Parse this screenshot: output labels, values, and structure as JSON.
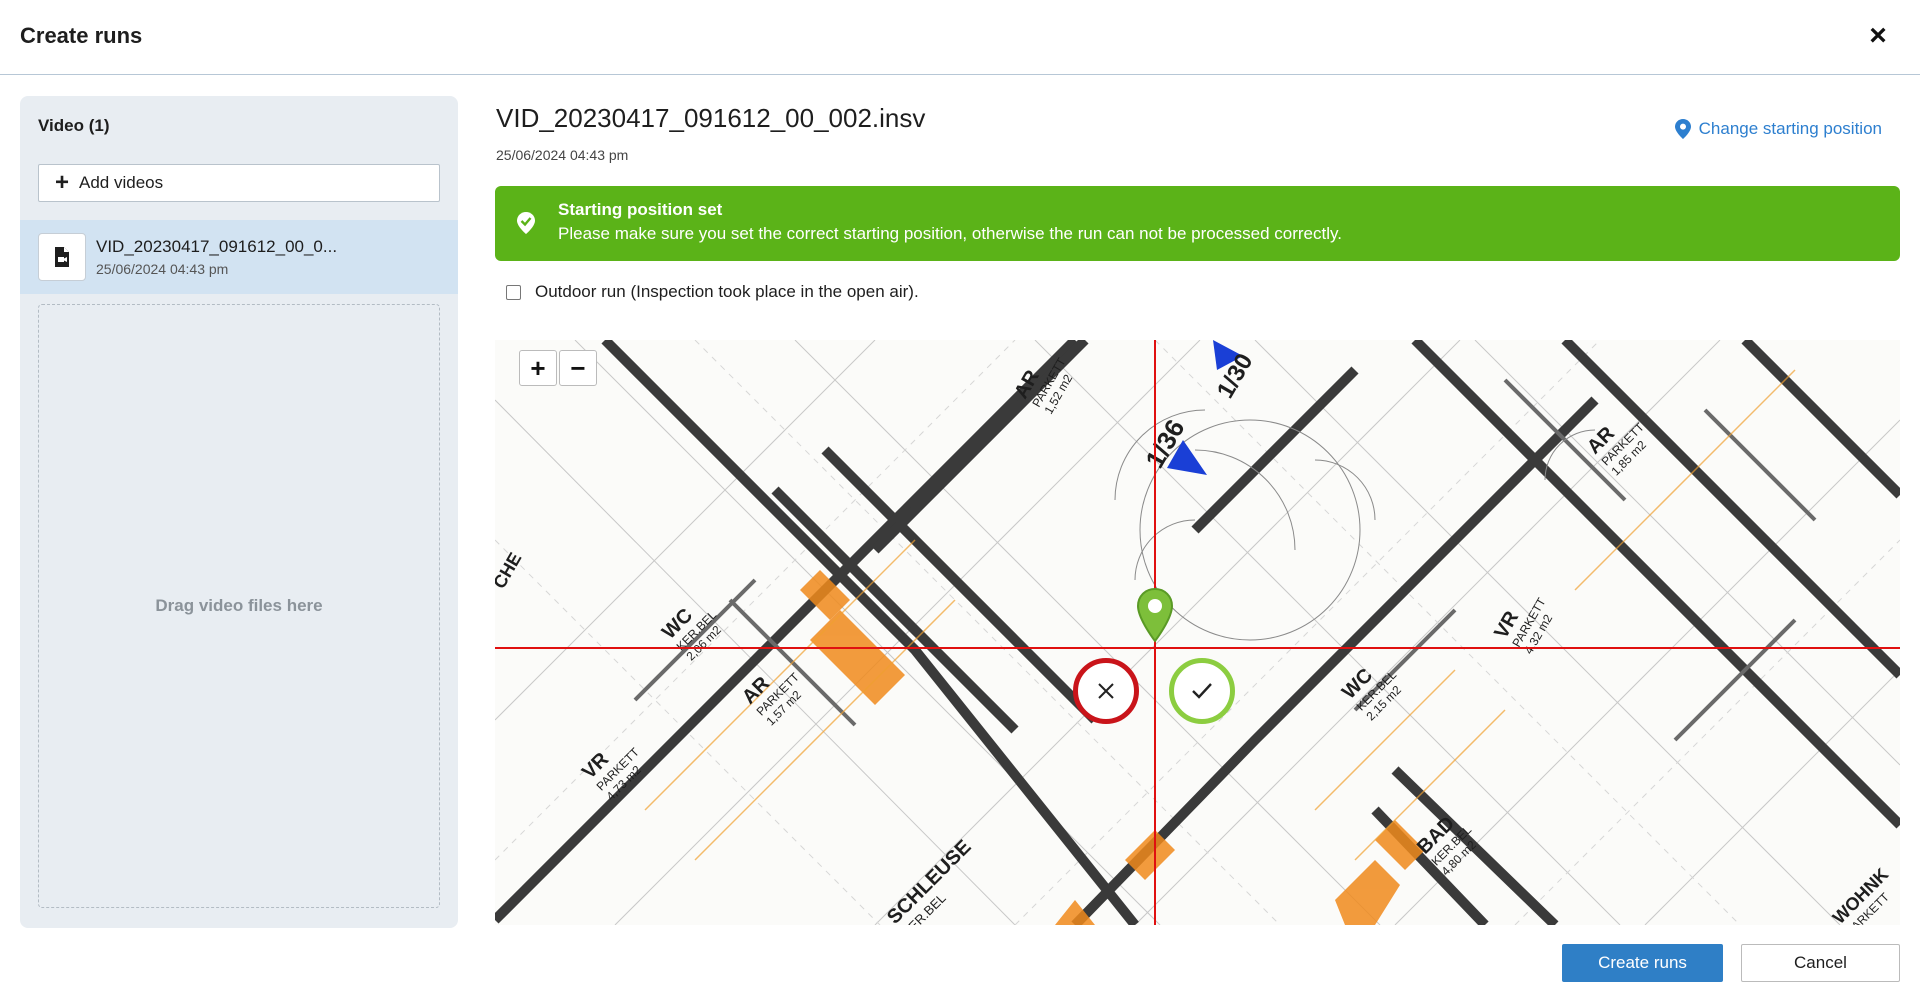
{
  "header": {
    "title": "Create runs",
    "close_glyph": "×"
  },
  "sidebar": {
    "heading": "Video (1)",
    "add_label": "Add videos",
    "videos": [
      {
        "name": "VID_20230417_091612_00_0...",
        "date": "25/06/2024 04:43 pm"
      }
    ],
    "dropzone_text": "Drag video files here"
  },
  "main": {
    "file_title": "VID_20230417_091612_00_002.insv",
    "file_date": "25/06/2024 04:43 pm",
    "change_position_label": "Change starting position",
    "banner": {
      "title": "Starting position set",
      "text": "Please make sure you set the correct starting position, otherwise the run can not be processed correctly."
    },
    "outdoor_label": "Outdoor run (Inspection took place in the open air).",
    "zoom": {
      "in": "+",
      "out": "−"
    },
    "plan_labels": {
      "wc1": "WC",
      "wc1_sub": "KER.BEL",
      "wc1_area": "2,06 m2",
      "ar1": "AR",
      "ar1_sub": "PARKETT",
      "ar1_area": "1,57 m2",
      "vr1": "VR",
      "vr1_sub": "PARKETT",
      "vr1_area": "4,73 m2",
      "schleuse": "SCHLEUSE",
      "schleuse_sub": "KER.BEL",
      "ar2": "AR",
      "ar2_sub": "PARKETT",
      "ar2_area": "1,52 m2",
      "wc2": "WC",
      "wc2_sub": "KER.BEL",
      "wc2_area": "2,15 m2",
      "bad": "BAD",
      "bad_sub": "KER.BEL",
      "bad_area": "4,80 m2",
      "vr2": "VR",
      "vr2_sub": "PARKETT",
      "vr2_area": "4,32 m2",
      "ar3": "AR",
      "ar3_sub": "PARKETT",
      "ar3_area": "1,85 m2",
      "wohnk": "WOHNK",
      "wohnk_sub": "PARKETT",
      "che": "CHE",
      "stair1": "1/36",
      "stair2": "1/30"
    }
  },
  "footer": {
    "create_label": "Create runs",
    "cancel_label": "Cancel"
  },
  "colors": {
    "accent": "#2f7fc6",
    "banner": "#5bb318",
    "reject": "#c9141a",
    "accept": "#8ccd40",
    "crosshair": "#e01010"
  }
}
